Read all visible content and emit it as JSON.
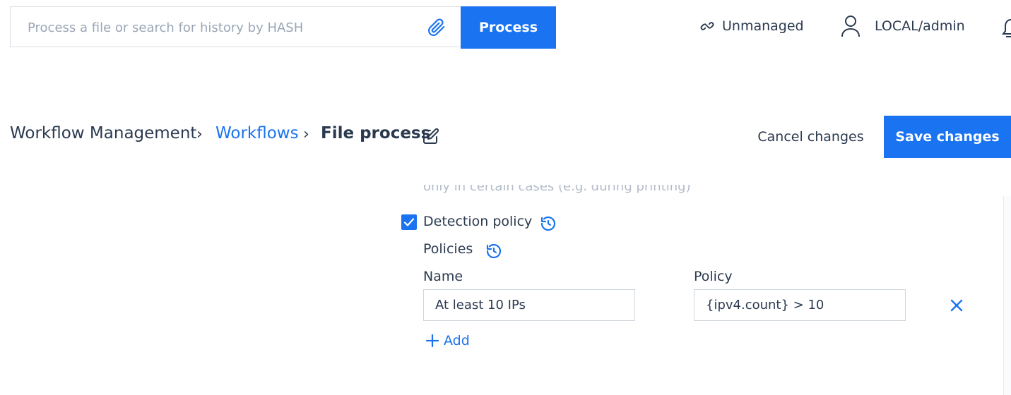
{
  "topbar": {
    "search_placeholder": "Process a file or search for history by HASH",
    "process_label": "Process",
    "management_status": "Unmanaged",
    "user": "LOCAL/admin"
  },
  "breadcrumb": {
    "root": "Workflow Management",
    "workflows": "Workflows",
    "current": "File process"
  },
  "actions": {
    "cancel_label": "Cancel changes",
    "save_label": "Save changes"
  },
  "content": {
    "clipped_text": "only in certain cases (e.g. during printing)",
    "detection_policy_label": "Detection policy",
    "detection_policy_checked": true,
    "policies_label": "Policies",
    "name_header": "Name",
    "policy_header": "Policy",
    "rows": [
      {
        "name": "At least 10 IPs",
        "policy": "{ipv4.count} > 10"
      }
    ],
    "add_label": "Add"
  },
  "colors": {
    "accent": "#1a73f0",
    "text": "#2b3a4f",
    "link": "#1a73f0"
  }
}
